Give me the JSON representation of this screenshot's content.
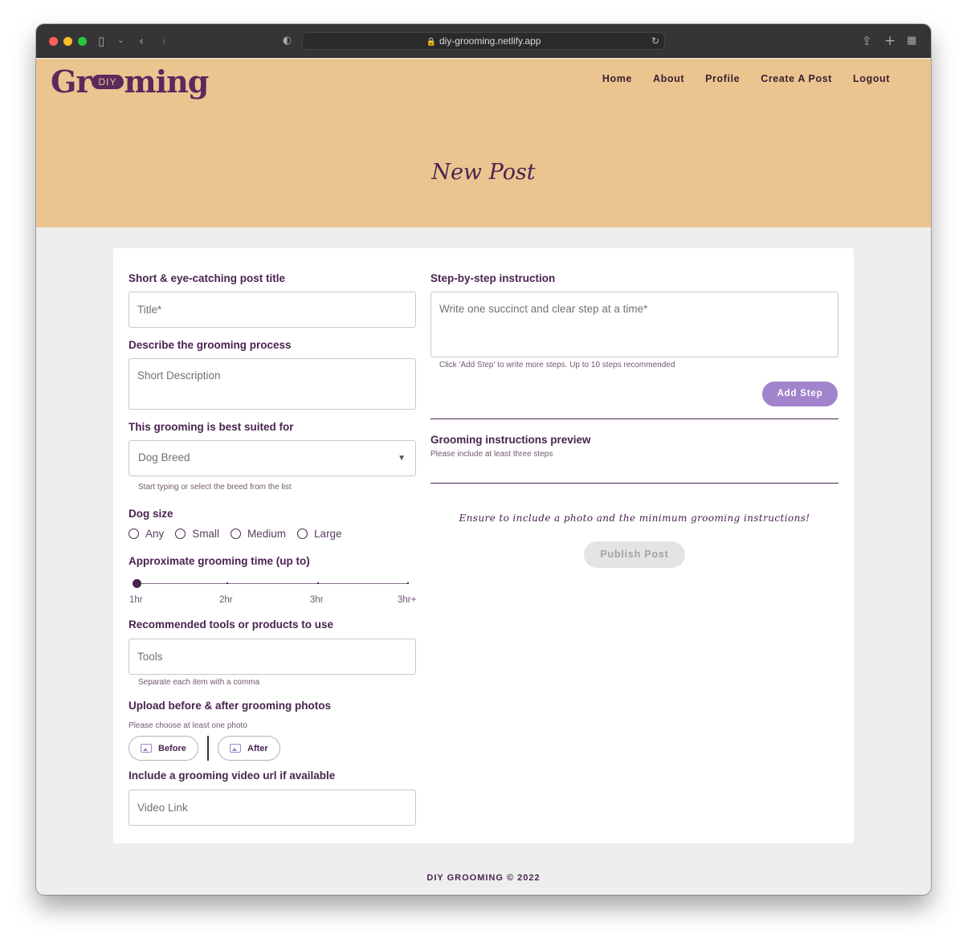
{
  "browser": {
    "url": "diy-grooming.netlify.app"
  },
  "site": {
    "logo_left": "Gr",
    "logo_badge": "DIY",
    "logo_right": "ming",
    "nav": [
      "Home",
      "About",
      "Profile",
      "Create A Post",
      "Logout"
    ],
    "page_title": "New Post"
  },
  "form": {
    "title_label": "Short & eye-catching post title",
    "title_placeholder": "Title*",
    "desc_label": "Describe the grooming process",
    "desc_placeholder": "Short Description",
    "breed_label": "This grooming is best suited for",
    "breed_value": "Dog Breed",
    "breed_helper": "Start typing or select the breed from the list",
    "size_label": "Dog size",
    "size_options": [
      "Any",
      "Small",
      "Medium",
      "Large"
    ],
    "time_label": "Approximate grooming time (up to)",
    "time_marks": [
      "1hr",
      "2hr",
      "3hr",
      "3hr+"
    ],
    "time_value": "1hr",
    "tools_label": "Recommended tools or products to use",
    "tools_placeholder": "Tools",
    "tools_helper": "Separate each item with a comma",
    "photos_label": "Upload before & after grooming photos",
    "photos_helper": "Please choose at least one photo",
    "before_label": "Before",
    "after_label": "After",
    "video_label": "Include a grooming video url if available",
    "video_placeholder": "Video Link",
    "steps_label": "Step-by-step instruction",
    "steps_placeholder": "Write one succinct and clear step at a time*",
    "steps_helper": "Click 'Add Step' to write more steps. Up to 10 steps recommended",
    "add_step_label": "Add Step",
    "preview_label": "Grooming instructions preview",
    "preview_helper": "Please include at least three steps",
    "ensure_text": "Ensure to include a photo and the minimum grooming instructions!",
    "publish_label": "Publish Post"
  },
  "footer": {
    "text": "DIY GROOMING © 2022"
  },
  "colors": {
    "header_bg": "#ebc590",
    "brand_purple": "#4a2350",
    "accent_lilac": "#a184cb",
    "page_bg": "#eeeeee"
  }
}
